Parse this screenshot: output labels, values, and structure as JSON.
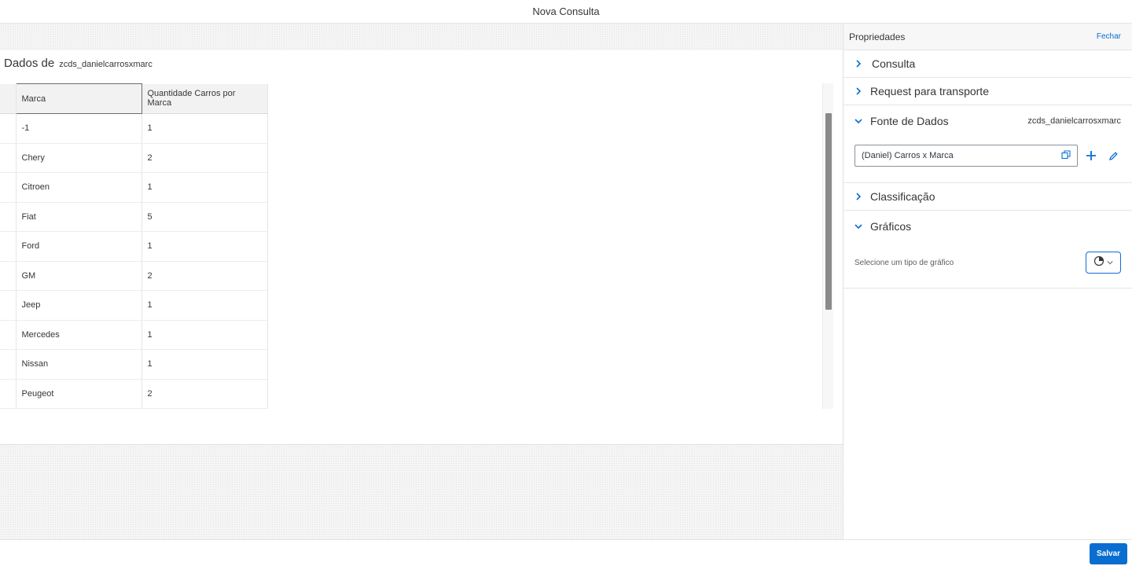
{
  "window": {
    "title": "Nova Consulta"
  },
  "main": {
    "data_title": "Dados de",
    "data_source_name": "zcds_danielcarrosxmarc",
    "table": {
      "columns": [
        "Marca",
        "Quantidade Carros por Marca"
      ],
      "rows": [
        [
          "-1",
          "1"
        ],
        [
          "Chery",
          "2"
        ],
        [
          "Citroen",
          "1"
        ],
        [
          "Fiat",
          "5"
        ],
        [
          "Ford",
          "1"
        ],
        [
          "GM",
          "2"
        ],
        [
          "Jeep",
          "1"
        ],
        [
          "Mercedes",
          "1"
        ],
        [
          "Nissan",
          "1"
        ],
        [
          "Peugeot",
          "2"
        ]
      ]
    }
  },
  "sidebar": {
    "title": "Propriedades",
    "close_label": "Fechar",
    "sections": {
      "consulta": "Consulta",
      "request": "Request para transporte",
      "fonte": "Fonte de Dados",
      "fonte_meta": "zcds_danielcarrosxmarc",
      "classificacao": "Classificação",
      "graficos": "Gráficos"
    },
    "datasource_value": "(Daniel) Carros x Marca",
    "chart_hint": "Selecione um tipo de gráfico"
  },
  "footer": {
    "save_label": "Salvar"
  },
  "colors": {
    "accent": "#0a6ed1",
    "text": "#32363a"
  },
  "icons": [
    "chevron-right-icon",
    "chevron-down-icon",
    "value-help-icon",
    "add-icon",
    "edit-icon",
    "chart-type-icon"
  ]
}
